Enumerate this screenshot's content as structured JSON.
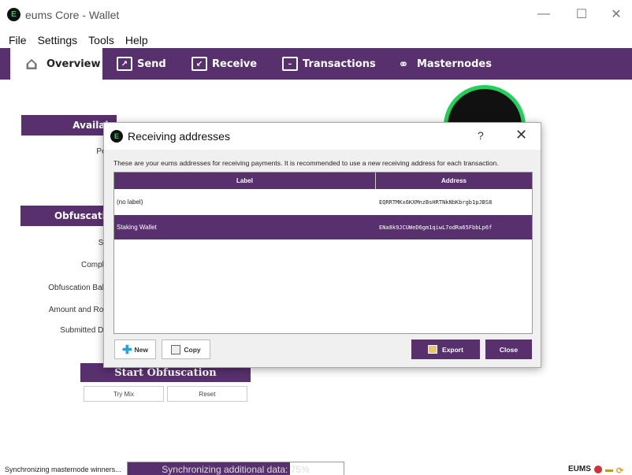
{
  "window": {
    "title": "eums Core - Wallet",
    "logo_glyph": "E",
    "minimize": "—",
    "maximize": "☐",
    "close": "✕"
  },
  "menu": [
    "File",
    "Settings",
    "Tools",
    "Help"
  ],
  "nav": {
    "overview": "Overview",
    "send": "Send",
    "receive": "Receive",
    "transactions": "Transactions",
    "masternodes": "Masternodes"
  },
  "overview": {
    "available_header": "Availab",
    "pending_label": "Pendi",
    "total_label": "To",
    "obfuscation_header": "Obfuscatio",
    "status_label": "Statu",
    "completion_label": "Completio",
    "obf_balance_label": "Obfuscation Balanc",
    "amount_rounds_label": "Amount and Round",
    "submitted_label": "Submitted Deno",
    "start_button": "Start Obfuscation",
    "try_mix_button": "Try Mix",
    "reset_button": "Reset"
  },
  "dialog": {
    "title": "Receiving addresses",
    "help": "?",
    "close_glyph": "✕",
    "description": "These are your eums addresses for receiving payments. It is recommended to use a new receiving address for each transaction.",
    "columns": {
      "label": "Label",
      "address": "Address"
    },
    "rows": [
      {
        "label": "(no label)",
        "address": "EQRRTMKx6KXMnzBsHRTNkNbKbrgb1pJBS8"
      },
      {
        "label": "Staking Wallet",
        "address": "ENa8k9JCUWeD6gm1qiwL7odRa65FbbLp6f"
      }
    ],
    "selected_row": 1,
    "buttons": {
      "new": "New",
      "copy": "Copy",
      "export": "Export",
      "close": "Close"
    }
  },
  "statusbar": {
    "left_text": "Synchronizing masternode winners...",
    "progress_text": "Synchronizing additional data: 75%",
    "progress_value": 0.75,
    "currency": "EUMS"
  },
  "colors": {
    "accent": "#58306e",
    "logo_green": "#23d05a"
  }
}
